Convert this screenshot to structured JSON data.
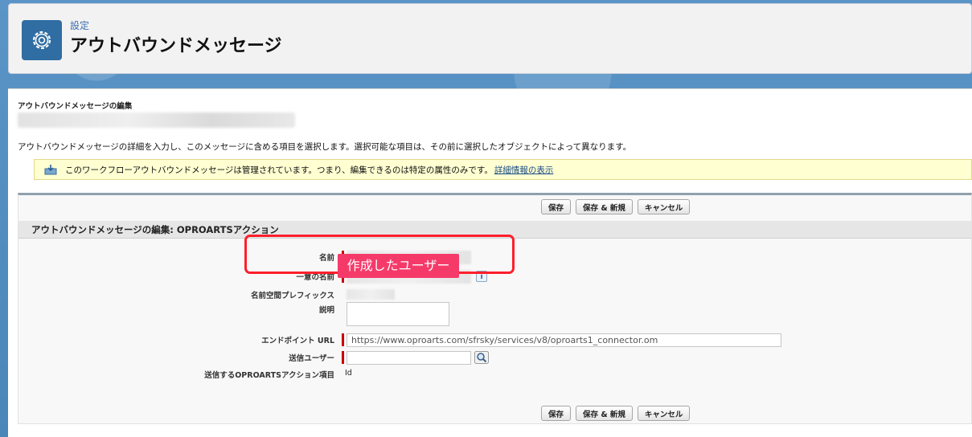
{
  "header": {
    "breadcrumb": "設定",
    "title": "アウトバウンドメッセージ"
  },
  "page": {
    "sub_title": "アウトバウンドメッセージの編集",
    "intro": "アウトバウンドメッセージの詳細を入力し、このメッセージに含める項目を選択します。選択可能な項目は、その前に選択したオブジェクトによって異なります。"
  },
  "notice": {
    "text": "このワークフローアウトバウンドメッセージは管理されています。つまり、編集できるのは特定の属性のみです。",
    "link": "詳細情報の表示"
  },
  "buttons": {
    "save": "保存",
    "save_new": "保存 & 新規",
    "cancel": "キャンセル"
  },
  "section": {
    "title": "アウトバウンドメッセージの編集: OPROARTSアクション"
  },
  "fields": {
    "name_label": "名前",
    "unique_name_label": "一意の名前",
    "namespace_label": "名前空間プレフィックス",
    "description_label": "説明",
    "endpoint_label": "エンドポイント URL",
    "endpoint_value": "https://www.oproarts.com/sfrsky/services/v8/oproarts1_connector.om",
    "sender_label": "送信ユーザー",
    "send_fields_label": "送信するOPROARTSアクション項目",
    "send_fields_value": "Id",
    "info_glyph": "i"
  },
  "annotation": {
    "label": "作成したユーザー",
    "color": "#f53a6a",
    "box_color": "#ff1f2b"
  },
  "icons": {
    "header": "gear-icon",
    "notice": "managed-package-icon",
    "lookup": "magnifier-lookup-icon"
  }
}
